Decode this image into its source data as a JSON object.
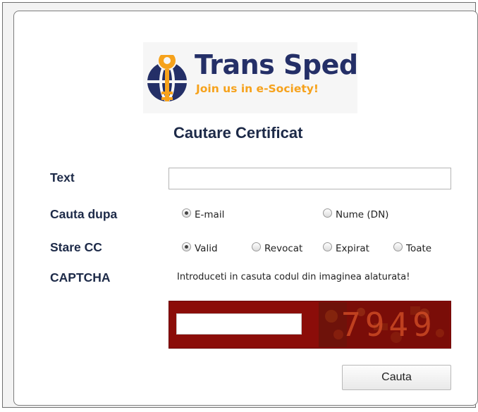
{
  "logo": {
    "brand": "Trans Sped",
    "tagline": "Join us in e-Society!"
  },
  "title": "Cautare Certificat",
  "text_field": {
    "label": "Text",
    "value": ""
  },
  "search_by": {
    "label": "Cauta dupa",
    "options": [
      "E-mail",
      "Nume (DN)"
    ],
    "selected": "E-mail"
  },
  "status": {
    "label": "Stare CC",
    "options": [
      "Valid",
      "Revocat",
      "Expirat",
      "Toate"
    ],
    "selected": "Valid"
  },
  "captcha": {
    "label": "CAPTCHA",
    "hint": "Introduceti in casuta codul din imaginea alaturata!",
    "value": "",
    "code": "7949"
  },
  "submit_label": "Cauta",
  "colors": {
    "label_text": "#1d2a48",
    "brand_navy": "#242f67",
    "brand_orange": "#f6a21c",
    "captcha_bg": "#8b0d09"
  }
}
